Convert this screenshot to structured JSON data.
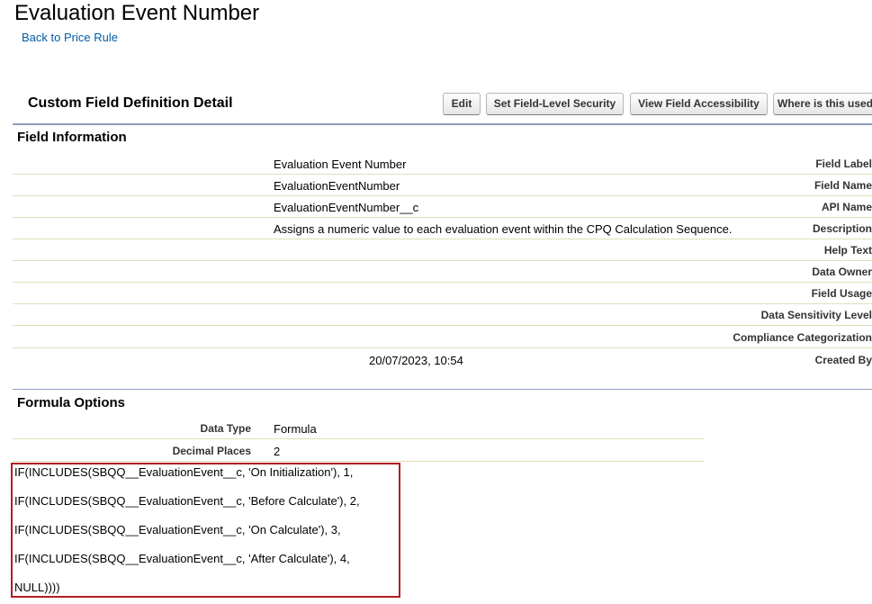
{
  "page": {
    "title": "Evaluation Event Number",
    "back_link": "Back to Price Rule"
  },
  "detail": {
    "header": "Custom Field Definition Detail",
    "buttons": {
      "edit": "Edit",
      "set_fls": "Set Field-Level Security",
      "view_access": "View Field Accessibility",
      "where_used": "Where is this used?"
    }
  },
  "field_info": {
    "title": "Field Information",
    "rows": [
      {
        "label": "Field Label",
        "value": "Evaluation Event Number"
      },
      {
        "label": "Field Name",
        "value": "EvaluationEventNumber"
      },
      {
        "label": "API Name",
        "value": "EvaluationEventNumber__c"
      },
      {
        "label": "Description",
        "value": "Assigns a numeric value to each evaluation event within the CPQ Calculation Sequence."
      },
      {
        "label": "Help Text",
        "value": ""
      },
      {
        "label": "Data Owner",
        "value": ""
      },
      {
        "label": "Field Usage",
        "value": ""
      },
      {
        "label": "Data Sensitivity Level",
        "value": ""
      },
      {
        "label": "Compliance Categorization",
        "value": ""
      },
      {
        "label": "Created By",
        "value": "20/07/2023, 10:54"
      }
    ]
  },
  "formula_options": {
    "title": "Formula Options",
    "rows": [
      {
        "label": "Data Type",
        "value": "Formula"
      },
      {
        "label": "Decimal Places",
        "value": "2"
      }
    ],
    "formula_lines": [
      "IF(INCLUDES(SBQQ__EvaluationEvent__c, 'On Initialization'), 1,",
      "IF(INCLUDES(SBQQ__EvaluationEvent__c, 'Before Calculate'), 2,",
      "IF(INCLUDES(SBQQ__EvaluationEvent__c, 'On Calculate'), 3,",
      "IF(INCLUDES(SBQQ__EvaluationEvent__c, 'After Calculate'), 4,",
      "NULL))))"
    ],
    "highlight_color": "#b01e23"
  },
  "colors": {
    "link": "#015ba7",
    "section_border": "#8e9dbe",
    "row_border": "#e3deb8"
  }
}
